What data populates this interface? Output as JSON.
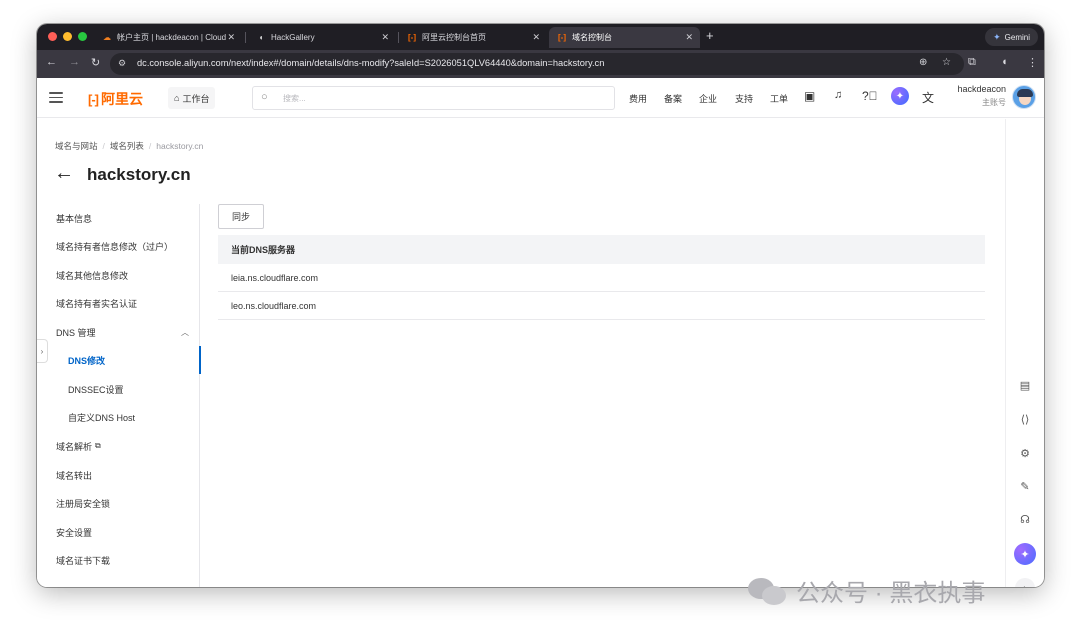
{
  "browser": {
    "tabs": [
      {
        "title": "帐户主页 | hackdeacon | Cloud",
        "favicon": "cloudflare-icon"
      },
      {
        "title": "HackGallery",
        "favicon": "gallery-icon"
      },
      {
        "title": "阿里云控制台首页",
        "favicon": "aliyun-icon"
      },
      {
        "title": "域名控制台",
        "favicon": "aliyun-icon",
        "active": true
      }
    ],
    "gemini_label": "Gemini",
    "url": "dc.console.aliyun.com/next/index#/domain/details/dns-modify?saleId=S2026051QLV64440&domain=hackstory.cn"
  },
  "header": {
    "logo_text": "阿里云",
    "workbench_label": "工作台",
    "search_placeholder": "搜索...",
    "nav": [
      "费用",
      "备案",
      "企业",
      "支持",
      "工单"
    ],
    "user_name": "hackdeacon",
    "user_role": "主账号"
  },
  "page": {
    "breadcrumb": [
      "域名与网站",
      "域名列表",
      "hackstory.cn"
    ],
    "title": "hackstory.cn"
  },
  "sidebar": {
    "items": [
      {
        "label": "基本信息"
      },
      {
        "label": "域名持有者信息修改（过户）"
      },
      {
        "label": "域名其他信息修改"
      },
      {
        "label": "域名持有者实名认证"
      },
      {
        "label": "DNS 管理",
        "expanded": true
      },
      {
        "label": "DNS修改",
        "sub": true,
        "active": true
      },
      {
        "label": "DNSSEC设置",
        "sub": true
      },
      {
        "label": "自定义DNS Host",
        "sub": true
      },
      {
        "label": "域名解析",
        "external": true
      },
      {
        "label": "域名转出"
      },
      {
        "label": "注册局安全锁"
      },
      {
        "label": "安全设置"
      },
      {
        "label": "域名证书下载"
      }
    ]
  },
  "main": {
    "sync_label": "同步",
    "table_header": "当前DNS服务器",
    "dns_servers": [
      "leia.ns.cloudflare.com",
      "leo.ns.cloudflare.com"
    ]
  },
  "watermark": "公众号 · 黑衣执事",
  "colors": {
    "brand_orange": "#ff6a00",
    "active_blue": "#0064c8",
    "tab_bar": "#1f1e24",
    "toolbar": "#3a3841"
  }
}
